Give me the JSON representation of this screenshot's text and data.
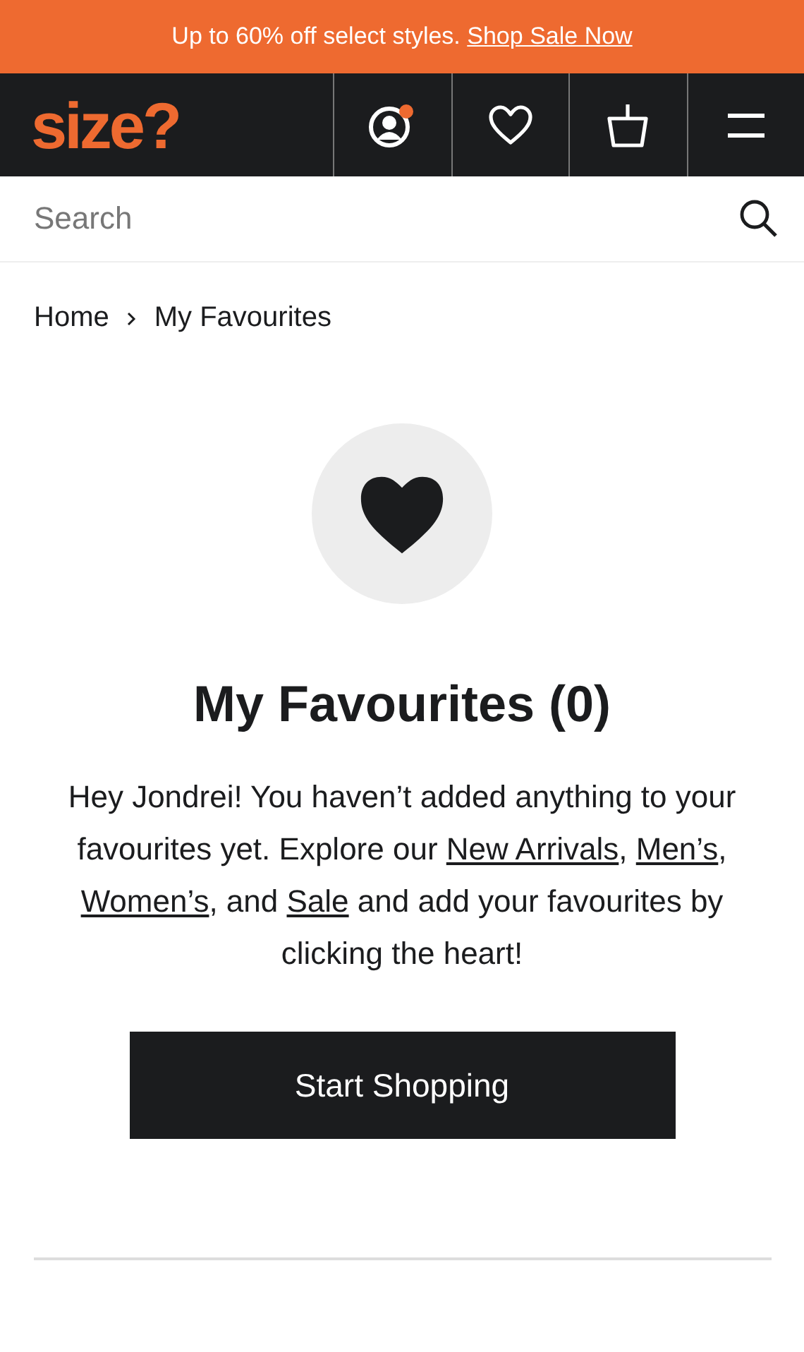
{
  "promo_banner": {
    "text": "Up to 60% off select styles. ",
    "link": "Shop Sale Now"
  },
  "header": {
    "logo": "size?",
    "account_notification": true,
    "nav_icons": [
      {
        "kind": "account"
      },
      {
        "kind": "favourites"
      },
      {
        "kind": "basket"
      },
      {
        "kind": "menu"
      }
    ]
  },
  "search": {
    "placeholder": "Search"
  },
  "breadcrumb": [
    "Home",
    "My Favourites"
  ],
  "title": "My Favourites (0)",
  "message": [
    {
      "text": "Hey Jondrei! You haven’t added anything to your favourites yet. Explore our ",
      "kind": "text"
    },
    {
      "text": "New Arrivals",
      "kind": "link"
    },
    {
      "text": ", ",
      "kind": "text"
    },
    {
      "text": "Men’s",
      "kind": "link"
    },
    {
      "text": ", ",
      "kind": "text"
    },
    {
      "text": "Women’s",
      "kind": "link"
    },
    {
      "text": ", and ",
      "kind": "text"
    },
    {
      "text": "Sale",
      "kind": "link"
    },
    {
      "text": " and add your favourites by clicking the heart!",
      "kind": "text"
    }
  ],
  "button": "Start Shopping"
}
